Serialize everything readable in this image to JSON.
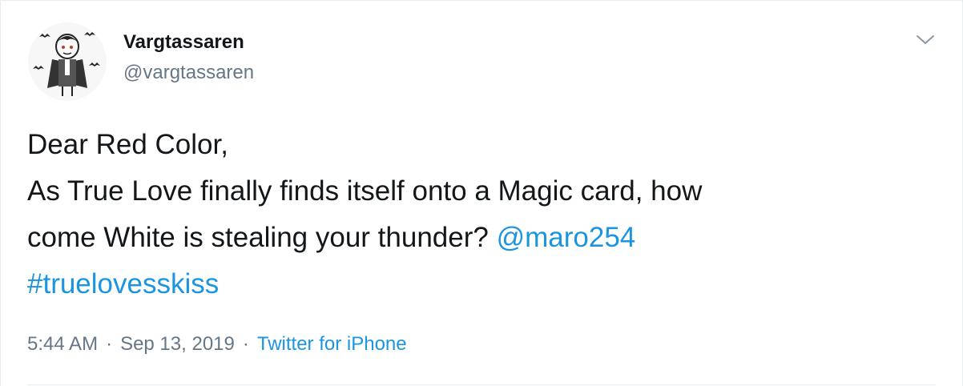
{
  "tweet": {
    "author": {
      "display_name": "Vargtassaren",
      "handle": "@vargtassaren",
      "avatar_icon": "vampire-cartoon-avatar"
    },
    "menu_icon": "chevron-down-icon",
    "text": {
      "line1": "Dear Red Color,",
      "line2": "As True Love finally finds itself onto a Magic card, how",
      "line3_prefix": "come White is stealing your thunder? ",
      "mention": "@maro254",
      "hashtag": "#truelovesskiss"
    },
    "meta": {
      "time": "5:44 AM",
      "separator": "·",
      "date": "Sep 13, 2019",
      "source": "Twitter for iPhone"
    },
    "colors": {
      "link": "#1b95e0",
      "text": "#14171a",
      "secondary": "#657786",
      "border": "#e6ecf0"
    }
  }
}
